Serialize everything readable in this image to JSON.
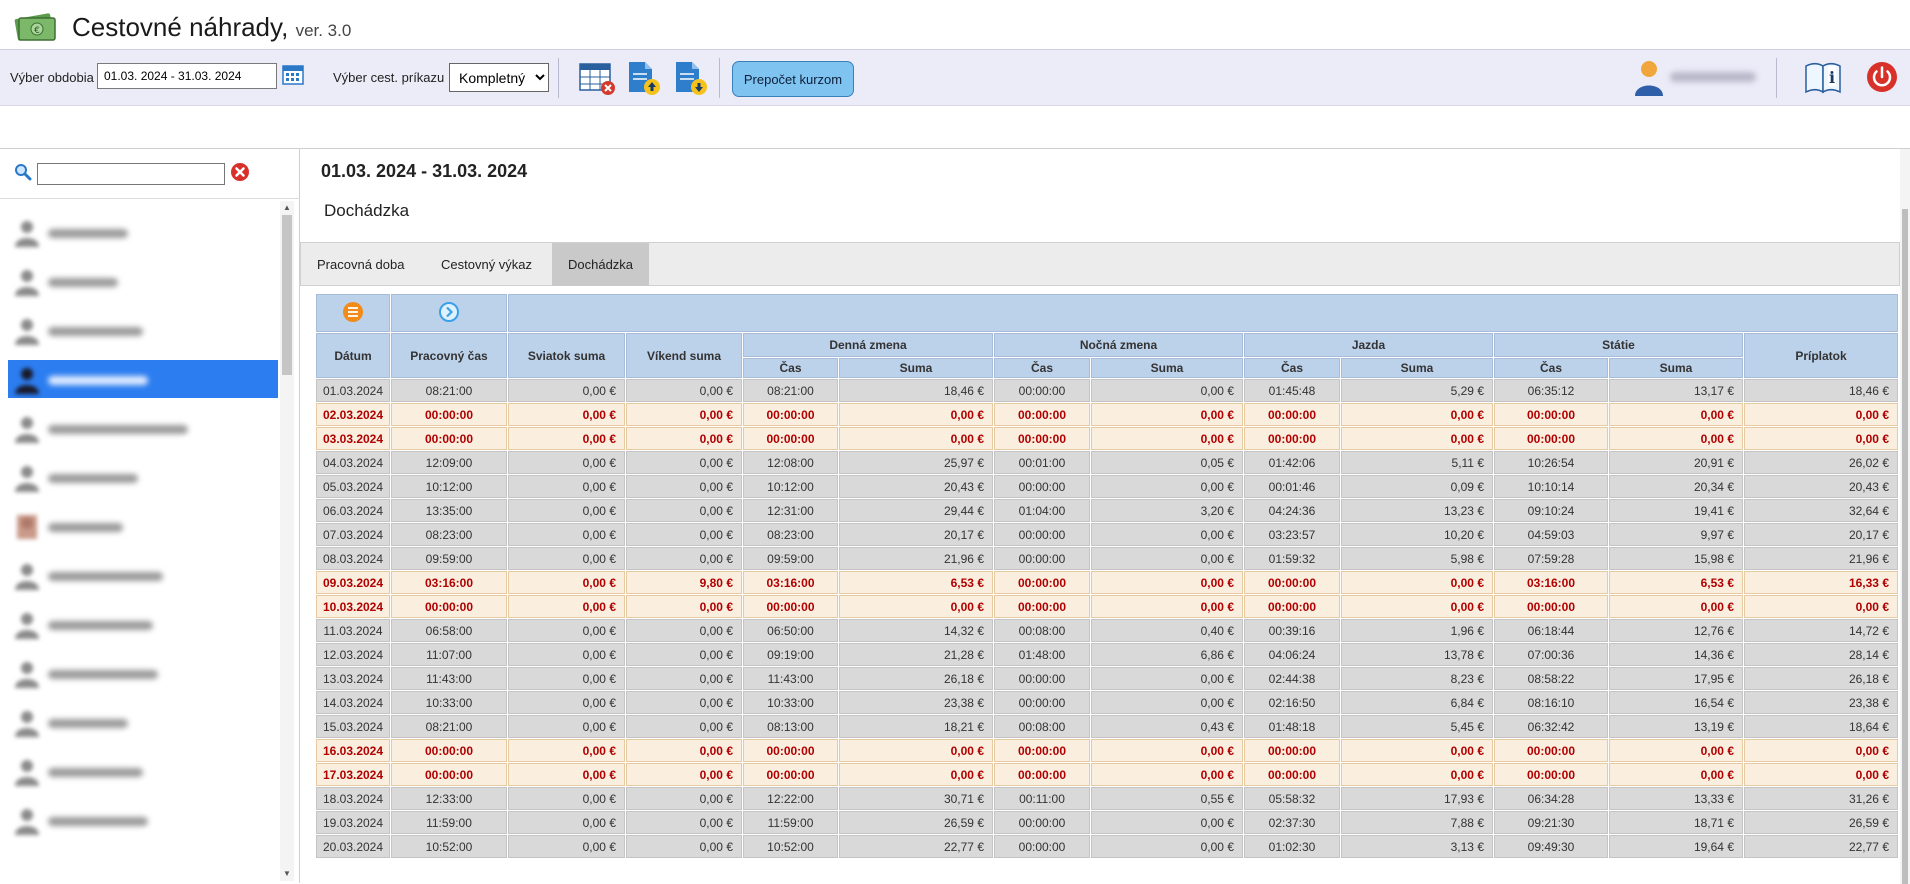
{
  "app": {
    "title": "Cestovné náhrady,",
    "version": "ver. 3.0"
  },
  "toolbar": {
    "period_label": "Výber obdobia",
    "period_value": "01.03. 2024 - 31.03. 2024",
    "order_label": "Výber cest. príkazu",
    "order_options": [
      "Kompletný"
    ],
    "order_value": "Kompletný",
    "rate_button": "Prepočet kurzom"
  },
  "sidebar": {
    "search_placeholder": "",
    "selected_index": 3,
    "item_count": 13
  },
  "main": {
    "period_title": "01.03. 2024 - 31.03. 2024",
    "section_title": "Dochádzka",
    "tabs": [
      "Pracovná doba",
      "Cestovný výkaz",
      "Dochádzka"
    ],
    "active_tab": 2
  },
  "table": {
    "headers": {
      "datum": "Dátum",
      "pracovny_cas": "Pracovný čas",
      "sviatok": "Sviatok suma",
      "vikend": "Víkend suma",
      "denna": "Denná zmena",
      "nocna": "Nočná zmena",
      "jazda": "Jazda",
      "statie": "Státie",
      "priplatok": "Príplatok",
      "cas": "Čas",
      "suma": "Suma"
    },
    "rows": [
      [
        "01.03.2024",
        "08:21:00",
        "0,00 €",
        "0,00 €",
        "08:21:00",
        "18,46 €",
        "00:00:00",
        "0,00 €",
        "01:45:48",
        "5,29 €",
        "06:35:12",
        "13,17 €",
        "18,46 €",
        false
      ],
      [
        "02.03.2024",
        "00:00:00",
        "0,00 €",
        "0,00 €",
        "00:00:00",
        "0,00 €",
        "00:00:00",
        "0,00 €",
        "00:00:00",
        "0,00 €",
        "00:00:00",
        "0,00 €",
        "0,00 €",
        true
      ],
      [
        "03.03.2024",
        "00:00:00",
        "0,00 €",
        "0,00 €",
        "00:00:00",
        "0,00 €",
        "00:00:00",
        "0,00 €",
        "00:00:00",
        "0,00 €",
        "00:00:00",
        "0,00 €",
        "0,00 €",
        true
      ],
      [
        "04.03.2024",
        "12:09:00",
        "0,00 €",
        "0,00 €",
        "12:08:00",
        "25,97 €",
        "00:01:00",
        "0,05 €",
        "01:42:06",
        "5,11 €",
        "10:26:54",
        "20,91 €",
        "26,02 €",
        false
      ],
      [
        "05.03.2024",
        "10:12:00",
        "0,00 €",
        "0,00 €",
        "10:12:00",
        "20,43 €",
        "00:00:00",
        "0,00 €",
        "00:01:46",
        "0,09 €",
        "10:10:14",
        "20,34 €",
        "20,43 €",
        false
      ],
      [
        "06.03.2024",
        "13:35:00",
        "0,00 €",
        "0,00 €",
        "12:31:00",
        "29,44 €",
        "01:04:00",
        "3,20 €",
        "04:24:36",
        "13,23 €",
        "09:10:24",
        "19,41 €",
        "32,64 €",
        false
      ],
      [
        "07.03.2024",
        "08:23:00",
        "0,00 €",
        "0,00 €",
        "08:23:00",
        "20,17 €",
        "00:00:00",
        "0,00 €",
        "03:23:57",
        "10,20 €",
        "04:59:03",
        "9,97 €",
        "20,17 €",
        false
      ],
      [
        "08.03.2024",
        "09:59:00",
        "0,00 €",
        "0,00 €",
        "09:59:00",
        "21,96 €",
        "00:00:00",
        "0,00 €",
        "01:59:32",
        "5,98 €",
        "07:59:28",
        "15,98 €",
        "21,96 €",
        false
      ],
      [
        "09.03.2024",
        "03:16:00",
        "0,00 €",
        "9,80 €",
        "03:16:00",
        "6,53 €",
        "00:00:00",
        "0,00 €",
        "00:00:00",
        "0,00 €",
        "03:16:00",
        "6,53 €",
        "16,33 €",
        true
      ],
      [
        "10.03.2024",
        "00:00:00",
        "0,00 €",
        "0,00 €",
        "00:00:00",
        "0,00 €",
        "00:00:00",
        "0,00 €",
        "00:00:00",
        "0,00 €",
        "00:00:00",
        "0,00 €",
        "0,00 €",
        true
      ],
      [
        "11.03.2024",
        "06:58:00",
        "0,00 €",
        "0,00 €",
        "06:50:00",
        "14,32 €",
        "00:08:00",
        "0,40 €",
        "00:39:16",
        "1,96 €",
        "06:18:44",
        "12,76 €",
        "14,72 €",
        false
      ],
      [
        "12.03.2024",
        "11:07:00",
        "0,00 €",
        "0,00 €",
        "09:19:00",
        "21,28 €",
        "01:48:00",
        "6,86 €",
        "04:06:24",
        "13,78 €",
        "07:00:36",
        "14,36 €",
        "28,14 €",
        false
      ],
      [
        "13.03.2024",
        "11:43:00",
        "0,00 €",
        "0,00 €",
        "11:43:00",
        "26,18 €",
        "00:00:00",
        "0,00 €",
        "02:44:38",
        "8,23 €",
        "08:58:22",
        "17,95 €",
        "26,18 €",
        false
      ],
      [
        "14.03.2024",
        "10:33:00",
        "0,00 €",
        "0,00 €",
        "10:33:00",
        "23,38 €",
        "00:00:00",
        "0,00 €",
        "02:16:50",
        "6,84 €",
        "08:16:10",
        "16,54 €",
        "23,38 €",
        false
      ],
      [
        "15.03.2024",
        "08:21:00",
        "0,00 €",
        "0,00 €",
        "08:13:00",
        "18,21 €",
        "00:08:00",
        "0,43 €",
        "01:48:18",
        "5,45 €",
        "06:32:42",
        "13,19 €",
        "18,64 €",
        false
      ],
      [
        "16.03.2024",
        "00:00:00",
        "0,00 €",
        "0,00 €",
        "00:00:00",
        "0,00 €",
        "00:00:00",
        "0,00 €",
        "00:00:00",
        "0,00 €",
        "00:00:00",
        "0,00 €",
        "0,00 €",
        true
      ],
      [
        "17.03.2024",
        "00:00:00",
        "0,00 €",
        "0,00 €",
        "00:00:00",
        "0,00 €",
        "00:00:00",
        "0,00 €",
        "00:00:00",
        "0,00 €",
        "00:00:00",
        "0,00 €",
        "0,00 €",
        true
      ],
      [
        "18.03.2024",
        "12:33:00",
        "0,00 €",
        "0,00 €",
        "12:22:00",
        "30,71 €",
        "00:11:00",
        "0,55 €",
        "05:58:32",
        "17,93 €",
        "06:34:28",
        "13,33 €",
        "31,26 €",
        false
      ],
      [
        "19.03.2024",
        "11:59:00",
        "0,00 €",
        "0,00 €",
        "11:59:00",
        "26,59 €",
        "00:00:00",
        "0,00 €",
        "02:37:30",
        "7,88 €",
        "09:21:30",
        "18,71 €",
        "26,59 €",
        false
      ],
      [
        "20.03.2024",
        "10:52:00",
        "0,00 €",
        "0,00 €",
        "10:52:00",
        "22,77 €",
        "00:00:00",
        "0,00 €",
        "01:02:30",
        "3,13 €",
        "09:49:30",
        "19,64 €",
        "22,77 €",
        false
      ]
    ]
  },
  "colors": {
    "accent": "#2c7df0",
    "header_bg": "#bcd1ea",
    "weekend_bg": "#faeedf",
    "weekend_text": "#b00000",
    "toolbar_bg": "#ecebf8"
  },
  "icons": {
    "logo": "money-icon",
    "calendar": "calendar-icon",
    "cancel_table": "table-delete-icon",
    "upload": "file-upload-icon",
    "download": "file-download-icon",
    "user": "user-icon",
    "manual": "manual-icon",
    "power": "power-icon",
    "search": "search-icon",
    "clear": "clear-icon",
    "list": "list-icon",
    "next": "next-icon"
  }
}
